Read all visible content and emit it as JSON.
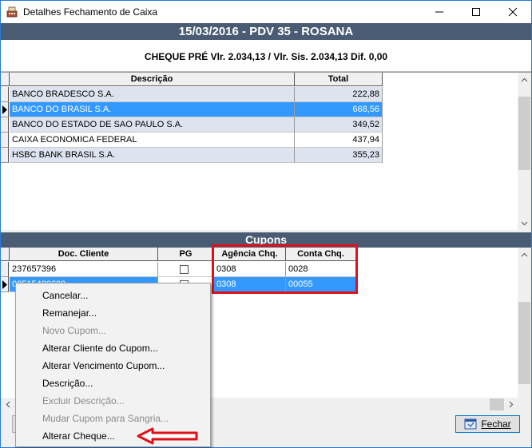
{
  "window": {
    "title": "Detalhes Fechamento de Caixa"
  },
  "header": {
    "title": "15/03/2016 - PDV 35 - ROSANA"
  },
  "summary": {
    "text": "CHEQUE PRÉ Vlr. 2.034,13 / Vlr. Sis. 2.034,13 Dif. 0,00"
  },
  "banks_table": {
    "columns": [
      "Descrição",
      "Total"
    ],
    "rows": [
      {
        "descricao": "BANCO BRADESCO S.A.",
        "total": "222,88"
      },
      {
        "descricao": "BANCO DO BRASIL S.A.",
        "total": "668,56"
      },
      {
        "descricao": "BANCO DO ESTADO DE SAO PAULO S.A.",
        "total": "349,52"
      },
      {
        "descricao": "CAIXA ECONOMICA FEDERAL",
        "total": "437,94"
      },
      {
        "descricao": "HSBC BANK BRASIL S.A.",
        "total": "355,23"
      }
    ],
    "selected_row": 1
  },
  "cupons": {
    "title": "Cupons",
    "columns": [
      "Doc. Cliente",
      "PG",
      "Agência Chq.",
      "Conta Chq."
    ],
    "rows": [
      {
        "doc": "237657396",
        "agencia": "0308",
        "conta": "0028"
      },
      {
        "doc": "00515400600",
        "agencia": "0308",
        "conta": "00055"
      }
    ],
    "selected_row": 1
  },
  "context_menu": {
    "items": [
      {
        "label": "Cancelar...",
        "enabled": true
      },
      {
        "label": "Remanejar...",
        "enabled": true
      },
      {
        "label": "Novo Cupom...",
        "enabled": false
      },
      {
        "label": "Alterar Cliente do Cupom...",
        "enabled": true
      },
      {
        "label": "Alterar Vencimento Cupom...",
        "enabled": true
      },
      {
        "label": "Descrição...",
        "enabled": true
      },
      {
        "label": "Excluir Descrição...",
        "enabled": false
      },
      {
        "label": "Mudar Cupom para Sangria...",
        "enabled": false
      },
      {
        "label": "Alterar Cheque...",
        "enabled": true
      }
    ]
  },
  "footer": {
    "close_label": "Fechar"
  },
  "colors": {
    "header_band": "#4a5c74",
    "selection": "#3399ff",
    "alt_row": "#dde4f0",
    "highlight_red": "#e0101a"
  }
}
